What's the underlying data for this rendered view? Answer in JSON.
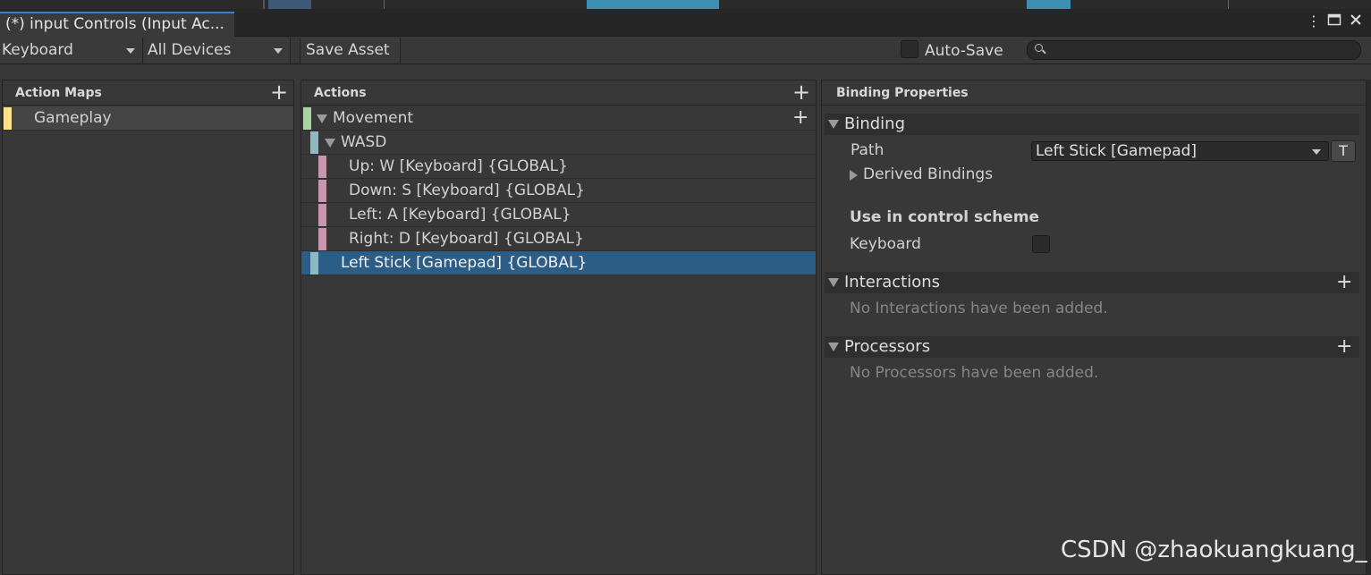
{
  "window": {
    "tab_title": "(*) input Controls (Input Ac...",
    "menu_icon": "kebab-menu-icon",
    "maximize_icon": "maximize-icon",
    "close_icon": "close-icon"
  },
  "toolbar": {
    "scheme_dropdown": "Keyboard",
    "devices_dropdown": "All Devices",
    "save_asset": "Save Asset",
    "auto_save_label": "Auto-Save",
    "auto_save_checked": false,
    "search_placeholder": ""
  },
  "action_maps": {
    "header": "Action Maps",
    "items": [
      {
        "label": "Gameplay",
        "color": "#ffe38a"
      }
    ]
  },
  "actions": {
    "header": "Actions",
    "action": {
      "label": "Movement",
      "color": "#a7d4a0"
    },
    "composite": {
      "label": "WASD",
      "color": "#8fb8c3"
    },
    "parts": [
      {
        "label": "Up: W [Keyboard] {GLOBAL}",
        "color": "#c797ad"
      },
      {
        "label": "Down: S [Keyboard] {GLOBAL}",
        "color": "#c797ad"
      },
      {
        "label": "Left: A [Keyboard] {GLOBAL}",
        "color": "#c797ad"
      },
      {
        "label": "Right: D [Keyboard] {GLOBAL}",
        "color": "#c797ad"
      }
    ],
    "selected_binding": {
      "label": "Left Stick [Gamepad] {GLOBAL}",
      "color": "#8fb8c3"
    }
  },
  "binding_properties": {
    "header": "Binding Properties",
    "binding_section": "Binding",
    "path_label": "Path",
    "path_value": "Left Stick [Gamepad]",
    "t_button": "T",
    "derived_bindings": "Derived Bindings",
    "control_scheme_heading": "Use in control scheme",
    "scheme_keyboard": "Keyboard",
    "scheme_keyboard_checked": false,
    "interactions_section": "Interactions",
    "interactions_empty": "No Interactions have been added.",
    "processors_section": "Processors",
    "processors_empty": "No Processors have been added."
  },
  "colors": {
    "selection": "#2c5d87",
    "panel_bg": "#383838"
  },
  "watermark": "CSDN @zhaokuangkuang_"
}
